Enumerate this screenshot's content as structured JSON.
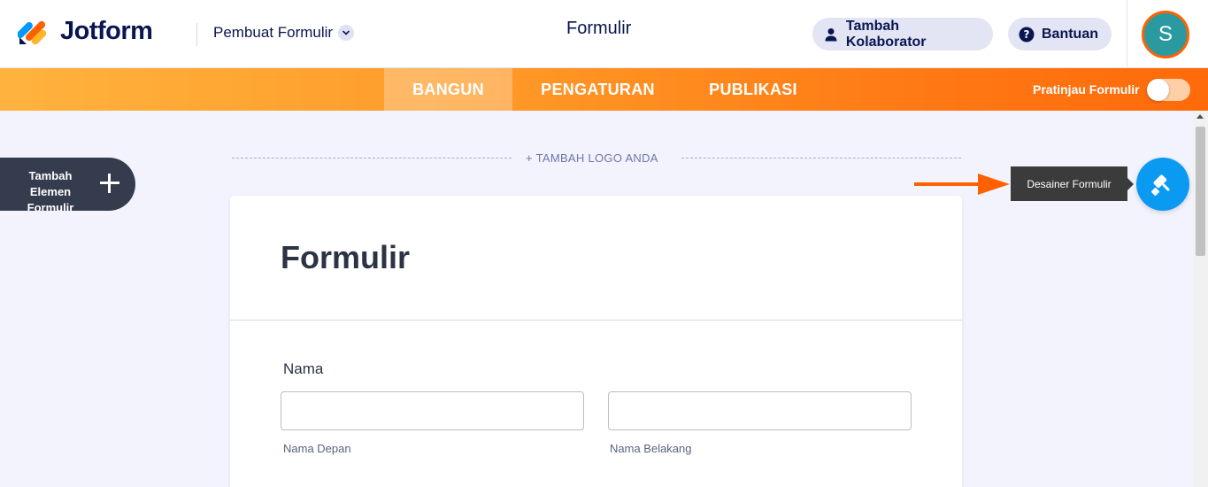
{
  "header": {
    "app_name": "Jotform",
    "builder_menu_label": "Pembuat Formulir",
    "page_title": "Formulir",
    "collaborator_button": "Tambah Kolaborator",
    "help_button": "Bantuan",
    "avatar_initial": "S"
  },
  "tabs": [
    {
      "label": "BANGUN",
      "active": true
    },
    {
      "label": "PENGATURAN",
      "active": false
    },
    {
      "label": "PUBLIKASI",
      "active": false
    }
  ],
  "preview": {
    "label": "Pratinjau Formulir",
    "enabled": false
  },
  "add_element": {
    "label": "Tambah Elemen Formulir"
  },
  "add_logo": {
    "label": "+ TAMBAH LOGO ANDA"
  },
  "designer": {
    "tooltip": "Desainer Formulir"
  },
  "form": {
    "heading": "Formulir",
    "fields": [
      {
        "label": "Nama",
        "first_value": "",
        "last_value": "",
        "first_sublabel": "Nama Depan",
        "last_sublabel": "Nama Belakang"
      }
    ]
  },
  "colors": {
    "accent_orange": "#ff6100",
    "designer_blue": "#0a9af2",
    "navy": "#0a1551",
    "avatar_teal": "#2b9aa0"
  },
  "icons": [
    "jotform-logo-icon",
    "chevron-down-icon",
    "user-icon",
    "help-icon",
    "plus-icon",
    "paint-roller-icon",
    "arrow-right-icon"
  ]
}
